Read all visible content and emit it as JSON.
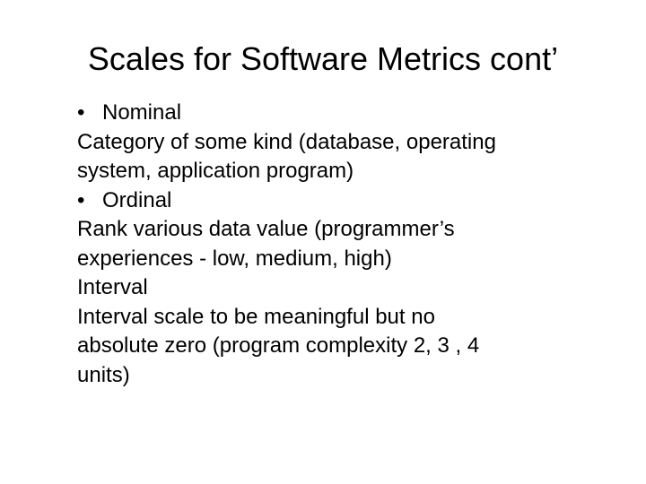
{
  "slide": {
    "title": "Scales for Software Metrics cont’",
    "body": {
      "bullet_char": "•",
      "nominal_heading": "Nominal",
      "nominal_line_1": "Category of some kind (database, operating",
      "nominal_line_2": "system, application program)",
      "ordinal_heading": "Ordinal",
      "ordinal_line_1": "Rank various data value (programmer’s",
      "ordinal_line_2": "experiences - low, medium, high)",
      "interval_heading": "Interval",
      "interval_line_1": "Interval scale to be meaningful but no",
      "interval_line_2": "absolute zero (program complexity 2, 3 , 4",
      "interval_line_3": "units)"
    }
  }
}
